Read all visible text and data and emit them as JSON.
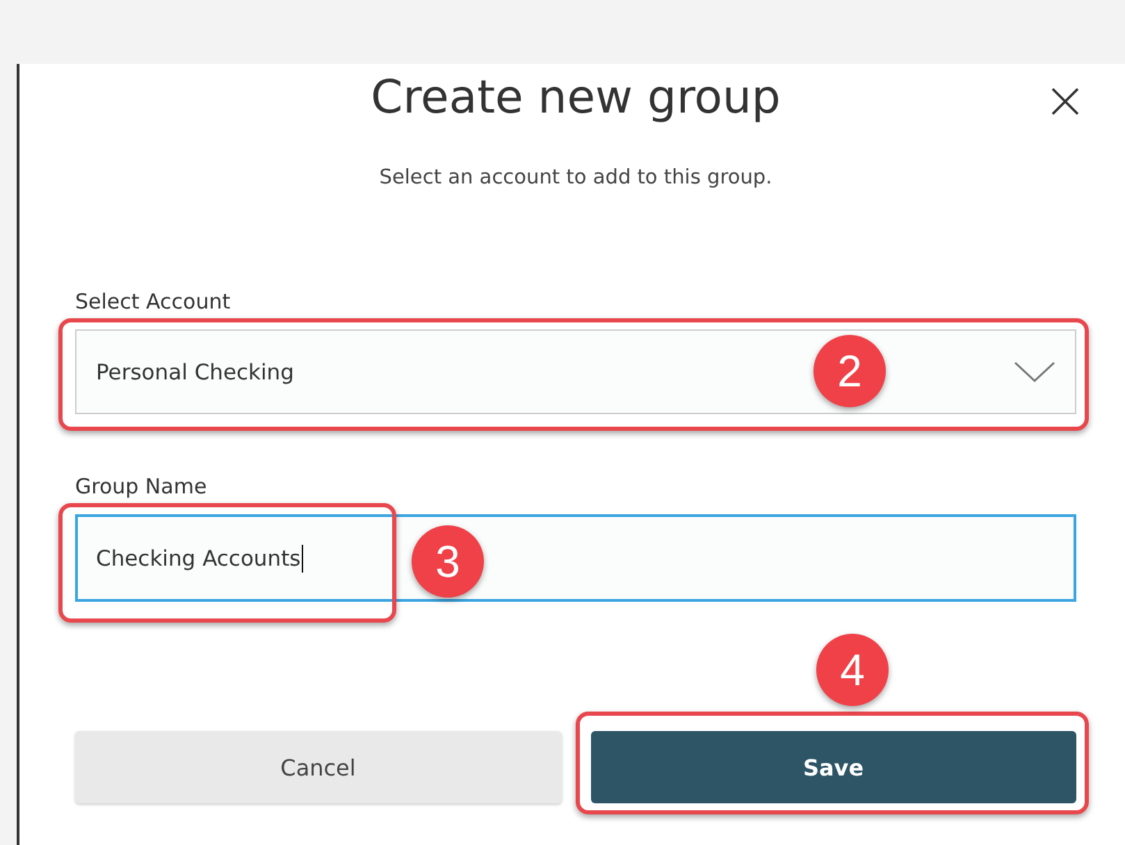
{
  "dialog": {
    "title": "Create new group",
    "subtitle": "Select an account to add to this group."
  },
  "account_field": {
    "label": "Select Account",
    "value": "Personal Checking"
  },
  "group_name_field": {
    "label": "Group Name",
    "value": "Checking Accounts",
    "focused": true
  },
  "buttons": [
    {
      "label": "Cancel",
      "kind": "secondary"
    },
    {
      "label": "Save",
      "kind": "primary"
    }
  ],
  "step_badges": [
    {
      "label": "2"
    },
    {
      "label": "3"
    },
    {
      "label": "4"
    }
  ]
}
